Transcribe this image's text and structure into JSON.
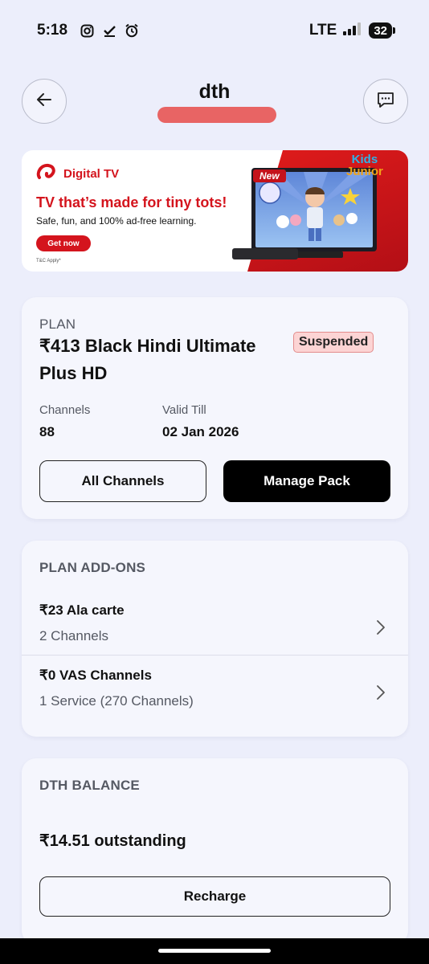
{
  "status_bar": {
    "time": "5:18",
    "network": "LTE",
    "battery": "32"
  },
  "header": {
    "title": "dth"
  },
  "banner": {
    "brand": "Digital TV",
    "headline": "TV that’s made for tiny tots!",
    "subline": "Safe, fun, and 100% ad-free learning.",
    "cta": "Get now",
    "terms": "T&C Apply*",
    "tag": "New",
    "logo_line1": "Kids",
    "logo_line2": "Junior",
    "brand_color": "#d4141d"
  },
  "plan": {
    "label": "PLAN",
    "name": "₹413 Black Hindi Ultimate Plus HD",
    "status": "Suspended",
    "channels_label": "Channels",
    "channels_value": "88",
    "valid_label": "Valid Till",
    "valid_value": "02 Jan 2026",
    "all_channels_label": "All Channels",
    "manage_pack_label": "Manage Pack"
  },
  "addons": {
    "label": "PLAN ADD-ONS",
    "items": [
      {
        "title": "₹23 Ala carte",
        "subtitle": "2 Channels"
      },
      {
        "title": "₹0 VAS Channels",
        "subtitle": "1 Service (270 Channels)"
      }
    ]
  },
  "balance": {
    "label": "DTH BALANCE",
    "value": "₹14.51 outstanding",
    "recharge_label": "Recharge"
  },
  "colors": {
    "background": "#eceefb",
    "card": "#f5f6fd",
    "badge_bg": "#fcd4d4",
    "redaction": "#e86464"
  }
}
